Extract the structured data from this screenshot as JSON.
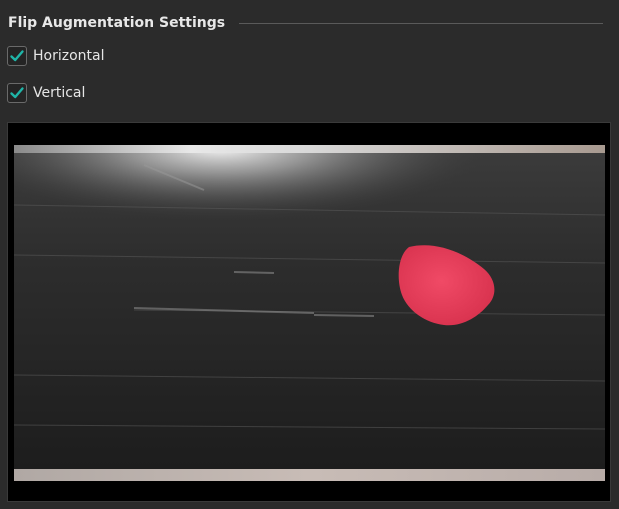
{
  "group": {
    "title": "Flip Augmentation Settings"
  },
  "options": {
    "horizontal": {
      "label": "Horizontal",
      "checked": true
    },
    "vertical": {
      "label": "Vertical",
      "checked": true
    }
  },
  "colors": {
    "panel_background": "#2b2b2b",
    "check_accent": "#1fb5a8",
    "preview_background": "#000000",
    "blob": "#e8405e"
  }
}
